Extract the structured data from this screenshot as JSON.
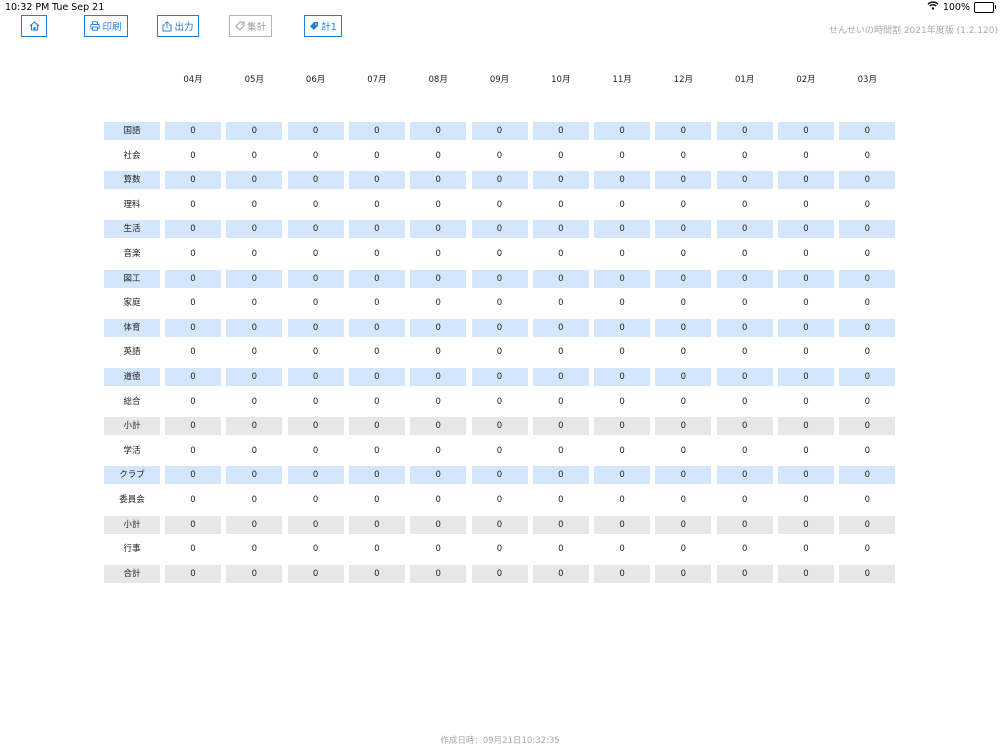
{
  "status_bar": {
    "time": "10:32 PM",
    "date": "Tue Sep 21",
    "battery": "100%"
  },
  "toolbar": {
    "print_label": "印刷",
    "export_label": "出力",
    "summary_label": "集計",
    "total_label": "計1"
  },
  "app_version": "せんせいの時間割 2021年度版 (1.2.120)",
  "months": [
    "04月",
    "05月",
    "06月",
    "07月",
    "08月",
    "09月",
    "10月",
    "11月",
    "12月",
    "01月",
    "02月",
    "03月"
  ],
  "rows": [
    {
      "label": "国語",
      "shade": "blue",
      "values": [
        "0",
        "0",
        "0",
        "0",
        "0",
        "0",
        "0",
        "0",
        "0",
        "0",
        "0",
        "0"
      ]
    },
    {
      "label": "社会",
      "shade": "none",
      "values": [
        "0",
        "0",
        "0",
        "0",
        "0",
        "0",
        "0",
        "0",
        "0",
        "0",
        "0",
        "0"
      ]
    },
    {
      "label": "算数",
      "shade": "blue",
      "values": [
        "0",
        "0",
        "0",
        "0",
        "0",
        "0",
        "0",
        "0",
        "0",
        "0",
        "0",
        "0"
      ]
    },
    {
      "label": "理科",
      "shade": "none",
      "values": [
        "0",
        "0",
        "0",
        "0",
        "0",
        "0",
        "0",
        "0",
        "0",
        "0",
        "0",
        "0"
      ]
    },
    {
      "label": "生活",
      "shade": "blue",
      "values": [
        "0",
        "0",
        "0",
        "0",
        "0",
        "0",
        "0",
        "0",
        "0",
        "0",
        "0",
        "0"
      ]
    },
    {
      "label": "音楽",
      "shade": "none",
      "values": [
        "0",
        "0",
        "0",
        "0",
        "0",
        "0",
        "0",
        "0",
        "0",
        "0",
        "0",
        "0"
      ]
    },
    {
      "label": "図工",
      "shade": "blue",
      "values": [
        "0",
        "0",
        "0",
        "0",
        "0",
        "0",
        "0",
        "0",
        "0",
        "0",
        "0",
        "0"
      ]
    },
    {
      "label": "家庭",
      "shade": "none",
      "values": [
        "0",
        "0",
        "0",
        "0",
        "0",
        "0",
        "0",
        "0",
        "0",
        "0",
        "0",
        "0"
      ]
    },
    {
      "label": "体育",
      "shade": "blue",
      "values": [
        "0",
        "0",
        "0",
        "0",
        "0",
        "0",
        "0",
        "0",
        "0",
        "0",
        "0",
        "0"
      ]
    },
    {
      "label": "英語",
      "shade": "none",
      "values": [
        "0",
        "0",
        "0",
        "0",
        "0",
        "0",
        "0",
        "0",
        "0",
        "0",
        "0",
        "0"
      ]
    },
    {
      "label": "道徳",
      "shade": "blue",
      "values": [
        "0",
        "0",
        "0",
        "0",
        "0",
        "0",
        "0",
        "0",
        "0",
        "0",
        "0",
        "0"
      ]
    },
    {
      "label": "総合",
      "shade": "none",
      "values": [
        "0",
        "0",
        "0",
        "0",
        "0",
        "0",
        "0",
        "0",
        "0",
        "0",
        "0",
        "0"
      ]
    },
    {
      "label": "小計",
      "shade": "gray",
      "values": [
        "0",
        "0",
        "0",
        "0",
        "0",
        "0",
        "0",
        "0",
        "0",
        "0",
        "0",
        "0"
      ]
    },
    {
      "label": "学活",
      "shade": "none",
      "values": [
        "0",
        "0",
        "0",
        "0",
        "0",
        "0",
        "0",
        "0",
        "0",
        "0",
        "0",
        "0"
      ]
    },
    {
      "label": "クラブ",
      "shade": "blue",
      "values": [
        "0",
        "0",
        "0",
        "0",
        "0",
        "0",
        "0",
        "0",
        "0",
        "0",
        "0",
        "0"
      ]
    },
    {
      "label": "委員会",
      "shade": "none",
      "values": [
        "0",
        "0",
        "0",
        "0",
        "0",
        "0",
        "0",
        "0",
        "0",
        "0",
        "0",
        "0"
      ]
    },
    {
      "label": "小計",
      "shade": "gray",
      "values": [
        "0",
        "0",
        "0",
        "0",
        "0",
        "0",
        "0",
        "0",
        "0",
        "0",
        "0",
        "0"
      ]
    },
    {
      "label": "行事",
      "shade": "none",
      "values": [
        "0",
        "0",
        "0",
        "0",
        "0",
        "0",
        "0",
        "0",
        "0",
        "0",
        "0",
        "0"
      ]
    },
    {
      "label": "合計",
      "shade": "gray",
      "values": [
        "0",
        "0",
        "0",
        "0",
        "0",
        "0",
        "0",
        "0",
        "0",
        "0",
        "0",
        "0"
      ]
    }
  ],
  "created_at": "作成日時：09月21日10:32:35",
  "colors": {
    "accent": "#1e7fe0",
    "row_blue": "#d3e6fc",
    "row_gray": "#e7e7e7"
  },
  "icons": {
    "home": "home-icon",
    "print": "printer-icon",
    "export": "share-icon",
    "summary": "tag-outline-icon",
    "total": "tag-filled-icon",
    "wifi": "wifi-icon",
    "battery": "battery-icon"
  }
}
